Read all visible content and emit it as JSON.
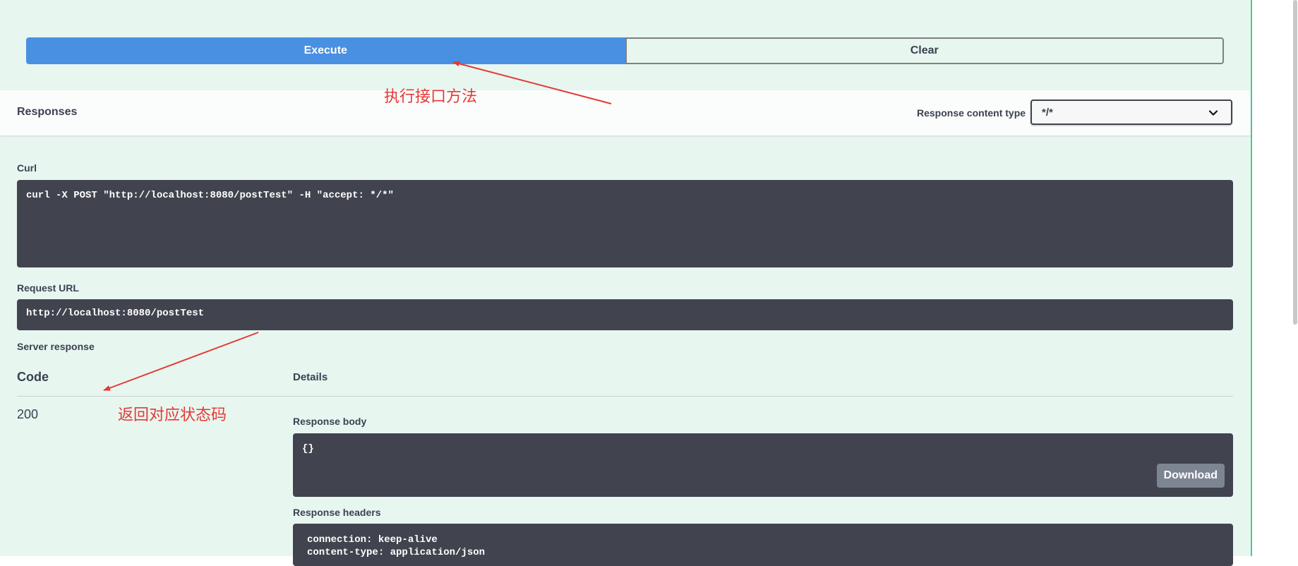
{
  "buttons": {
    "execute": "Execute",
    "clear": "Clear"
  },
  "responses": {
    "title": "Responses",
    "content_type_label": "Response content type",
    "content_type_value": "*/*"
  },
  "curl": {
    "label": "Curl",
    "command": "curl -X POST \"http://localhost:8080/postTest\" -H \"accept: */*\""
  },
  "request_url": {
    "label": "Request URL",
    "value": "http://localhost:8080/postTest"
  },
  "server_response": {
    "label": "Server response",
    "code_header": "Code",
    "details_header": "Details",
    "code": "200",
    "body_label": "Response body",
    "body": "{}",
    "download_label": "Download",
    "headers_label": "Response headers",
    "headers_lines": [
      "connection: keep-alive",
      "content-type: application/json"
    ]
  },
  "annotations": {
    "execute_note": "执行接口方法",
    "status_note": "返回对应状态码"
  },
  "colors": {
    "panel_bg": "#e8f6f0",
    "execute_blue": "#4990e2",
    "code_bg": "#41444e",
    "annotation_red": "#e53935",
    "border_green": "#49cc90"
  }
}
